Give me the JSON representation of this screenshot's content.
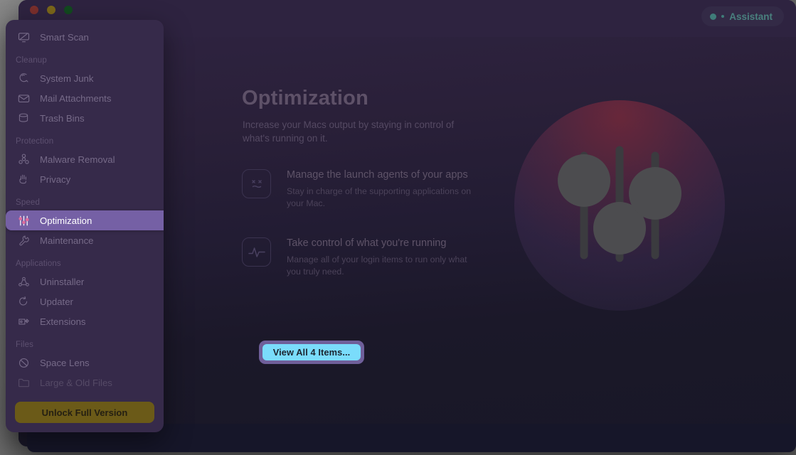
{
  "window": {
    "traffic_lights": [
      "close",
      "minimize",
      "zoom"
    ],
    "assistant_label": "Assistant"
  },
  "colors": {
    "window_bg": "#2e2340",
    "content_bg": "#181727",
    "sidebar_bg": "#362a4a",
    "active_item": "#7560a5",
    "cta_fill": "#7adcfb",
    "cta_ring": "#6f5f9a",
    "unlock_fill": "#6b5a18",
    "assistant_accent": "#3f7c79"
  },
  "sidebar": {
    "top_items": [
      {
        "label": "Smart Scan",
        "icon": "monitor-scan-icon",
        "state": "normal"
      }
    ],
    "groups": [
      {
        "label": "Cleanup",
        "items": [
          {
            "label": "System Junk",
            "icon": "broom-icon",
            "state": "normal"
          },
          {
            "label": "Mail Attachments",
            "icon": "envelope-icon",
            "state": "normal"
          },
          {
            "label": "Trash Bins",
            "icon": "trash-bin-icon",
            "state": "normal"
          }
        ]
      },
      {
        "label": "Protection",
        "items": [
          {
            "label": "Malware Removal",
            "icon": "biohazard-icon",
            "state": "normal"
          },
          {
            "label": "Privacy",
            "icon": "hand-icon",
            "state": "normal"
          }
        ]
      },
      {
        "label": "Speed",
        "items": [
          {
            "label": "Optimization",
            "icon": "sliders-icon",
            "state": "active"
          },
          {
            "label": "Maintenance",
            "icon": "wrench-icon",
            "state": "normal"
          }
        ]
      },
      {
        "label": "Applications",
        "items": [
          {
            "label": "Uninstaller",
            "icon": "uninstall-icon",
            "state": "normal"
          },
          {
            "label": "Updater",
            "icon": "refresh-arrow-icon",
            "state": "normal"
          },
          {
            "label": "Extensions",
            "icon": "puzzle-piece-icon",
            "state": "normal"
          }
        ]
      },
      {
        "label": "Files",
        "items": [
          {
            "label": "Space Lens",
            "icon": "space-lens-icon",
            "state": "normal"
          },
          {
            "label": "Large & Old Files",
            "icon": "folder-icon",
            "state": "dim"
          }
        ]
      }
    ],
    "unlock_label": "Unlock Full Version"
  },
  "main": {
    "title": "Optimization",
    "subtitle": "Increase your Macs output by staying in control of what's running on it.",
    "features": [
      {
        "icon": "dead-face-icon",
        "title": "Manage the launch agents of your apps",
        "desc": "Stay in charge of the supporting applications on your Mac."
      },
      {
        "icon": "pulse-waveform-icon",
        "title": "Take control of what you're running",
        "desc": "Manage all of your login items to run only what you truly need."
      }
    ],
    "cta_label": "View All 4 Items...",
    "hero_art": "equalizer-sliders-circle-icon"
  }
}
